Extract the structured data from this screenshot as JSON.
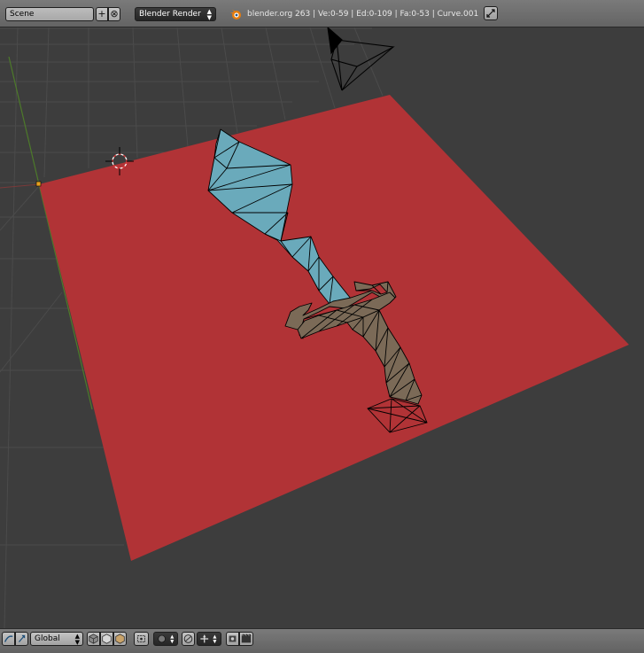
{
  "top_header": {
    "scene_name": "Scene",
    "add_scene_icon": "plus-icon",
    "remove_scene_icon": "x-icon",
    "render_engine": "Blender Render",
    "stats": "blender.org 263 | Ve:0-59 | Ed:0-109 | Fa:0-53 | Curve.001"
  },
  "bottom_header": {
    "transform_orientation": "Global",
    "icons": [
      "editor-type-icon",
      "interaction-mode-icon",
      "viewport-shading-solid-icon",
      "viewport-shading-wire-icon",
      "viewport-shading-texture-icon",
      "pivot-point-icon",
      "proportional-edit-icon",
      "manipulator-icon",
      "snap-icon",
      "render-icon",
      "render-animation-icon"
    ]
  },
  "colors": {
    "plane": "#b13336",
    "blade": "#6aaabb",
    "hilt": "#7b6a57",
    "grid": "#4b4b4b",
    "background": "#3d3d3d"
  }
}
